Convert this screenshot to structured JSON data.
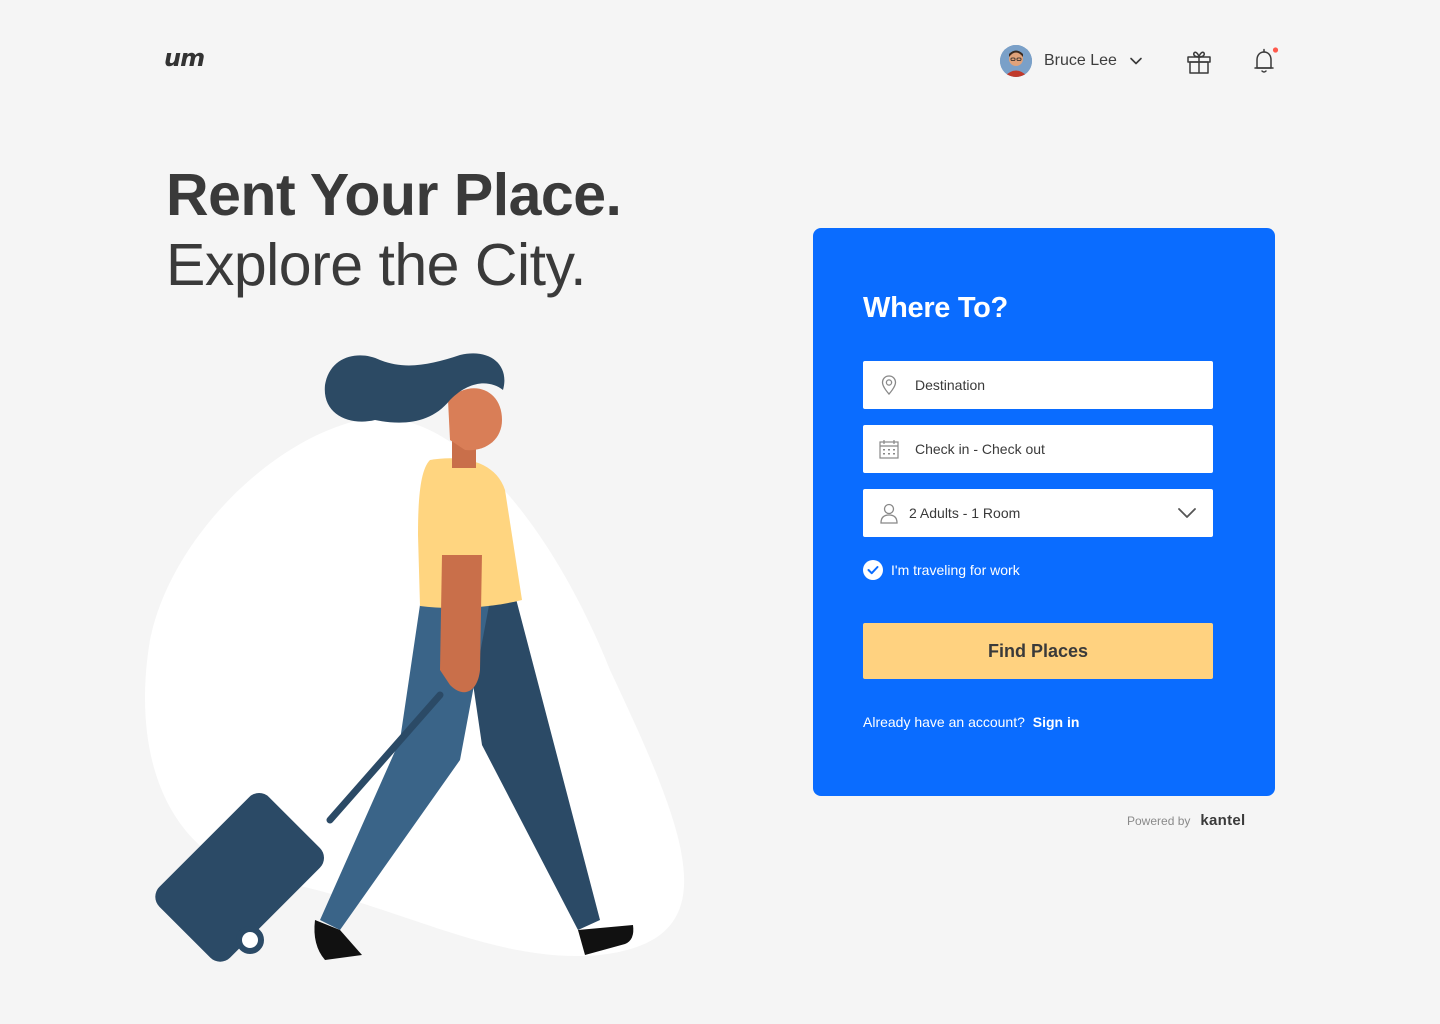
{
  "header": {
    "logo": "um",
    "user": {
      "name": "Bruce Lee"
    },
    "has_notification": true
  },
  "hero": {
    "title_line1": "Rent Your Place.",
    "title_line2": "Explore the City."
  },
  "search": {
    "title": "Where To?",
    "destination_placeholder": "Destination",
    "dates_placeholder": "Check in - Check out",
    "guests_value": "2 Adults - 1 Room",
    "work_travel_label": "I'm traveling for work",
    "work_travel_checked": true,
    "submit_label": "Find Places",
    "account_prompt": "Already have an account?",
    "signin_label": "Sign in"
  },
  "footer": {
    "powered_label": "Powered by",
    "powered_brand": "kantel"
  },
  "colors": {
    "background": "#f5f5f5",
    "card": "#0a6cff",
    "button": "#ffd280",
    "notification_dot": "#ff5a4d"
  },
  "icons": {
    "destination": "map-pin-icon",
    "dates": "calendar-icon",
    "guests": "user-icon",
    "gift": "gift-icon",
    "notifications": "bell-icon"
  }
}
